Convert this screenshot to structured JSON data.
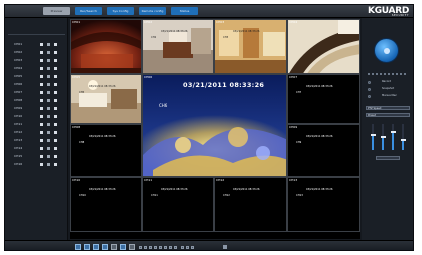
{
  "top_menu": {
    "tabs": [
      "Preview",
      "Rec/Search",
      "Sys Config",
      "Remote config",
      "Status"
    ],
    "active_tab": 0
  },
  "logo": {
    "name": "KGUARD",
    "sub": "SECURITY"
  },
  "left_panel": {
    "rows": [
      "CH01",
      "CH02",
      "CH03",
      "CH04",
      "CH05",
      "CH06",
      "CH07",
      "CH08",
      "CH09",
      "CH10",
      "CH11",
      "CH12",
      "CH13",
      "CH14",
      "CH15",
      "CH16"
    ]
  },
  "channels": [
    {
      "id": "CH01",
      "timestamp": "",
      "cam": ""
    },
    {
      "id": "CH02",
      "timestamp": "03/21/2011 08:33:26",
      "cam": "CH2"
    },
    {
      "id": "CH03",
      "timestamp": "03/21/2011 08:33:26",
      "cam": "CH3"
    },
    {
      "id": "CH04",
      "timestamp": "",
      "cam": ""
    },
    {
      "id": "CH05",
      "timestamp": "03/21/2011 08:33:26",
      "cam": "CH5"
    },
    {
      "id": "CH06",
      "timestamp": "03/21/2011 08:33:26",
      "cam": "CH6"
    },
    {
      "id": "CH07",
      "timestamp": "03/21/2011 08:33:26",
      "cam": "CH7"
    },
    {
      "id": "CH08",
      "timestamp": "03/21/2011 08:33:26",
      "cam": "CH8"
    },
    {
      "id": "CH09",
      "timestamp": "03/21/2011 08:33:26",
      "cam": "CH9"
    },
    {
      "id": "CH10",
      "timestamp": "03/21/2011 08:33:26",
      "cam": "CH10"
    },
    {
      "id": "CH11",
      "timestamp": "03/21/2011 08:33:26",
      "cam": "CH11"
    },
    {
      "id": "CH12",
      "timestamp": "03/21/2011 08:33:26",
      "cam": "CH12"
    },
    {
      "id": "CH13",
      "timestamp": "03/21/2011 08:33:26",
      "cam": "CH13"
    }
  ],
  "right_panel": {
    "options": [
      "Record",
      "Snapshot",
      "Manual Rec"
    ],
    "dropdowns": [
      "PTZ Speed",
      "Preset"
    ],
    "slider_levels": [
      0.55,
      0.45,
      0.65,
      0.35
    ]
  },
  "colors": {
    "accent": "#1f6fb8",
    "background": "#15191f",
    "ptz": "#1564b4"
  }
}
